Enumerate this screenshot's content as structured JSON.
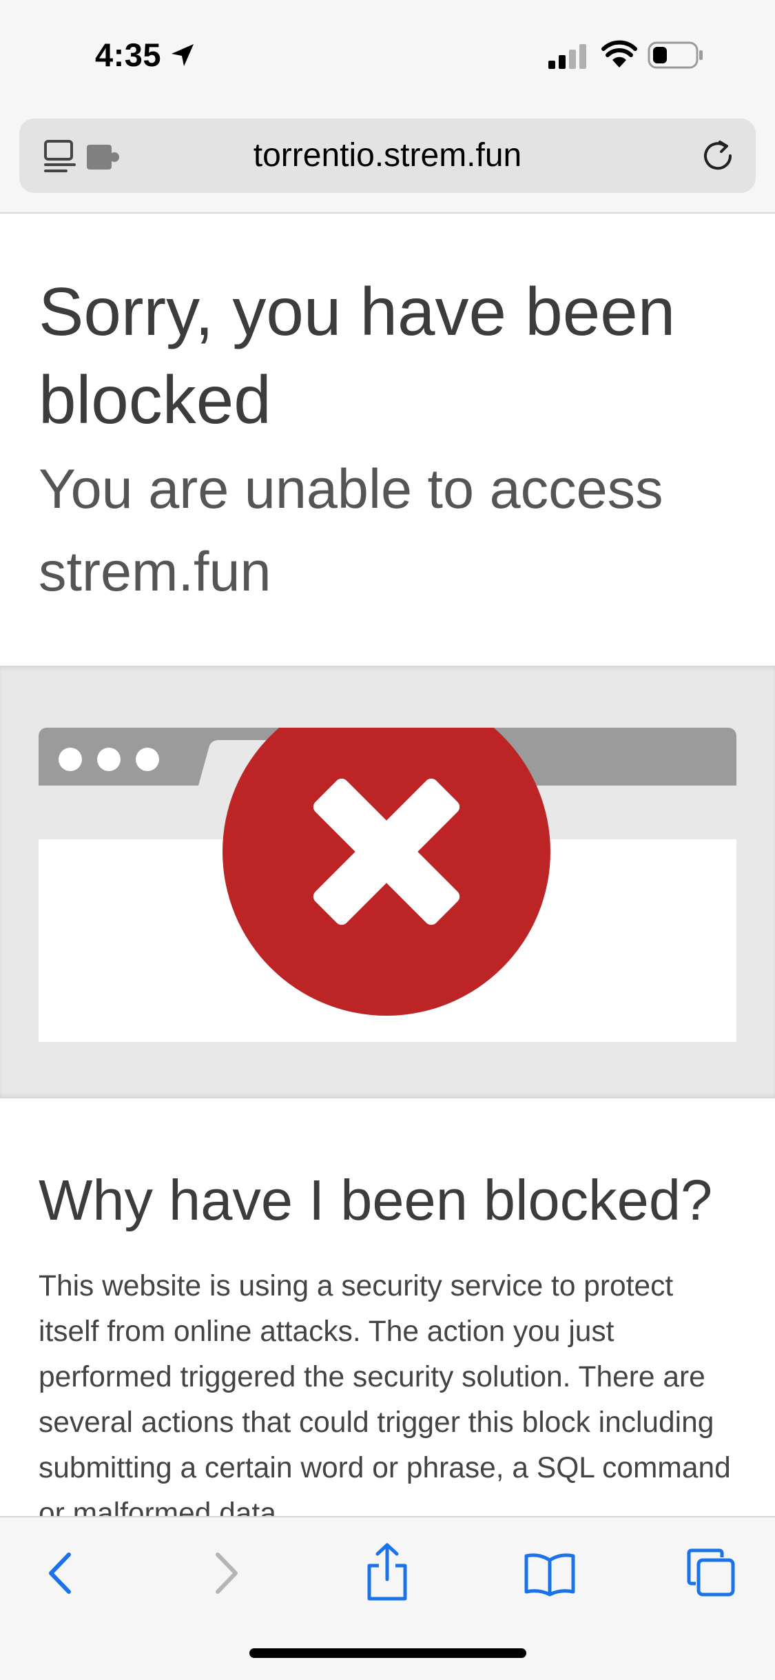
{
  "status_bar": {
    "time": "4:35",
    "icons": [
      "location-arrow-icon",
      "cellular-signal-icon",
      "wifi-icon",
      "battery-icon"
    ]
  },
  "address_bar": {
    "url": "torrentio.strem.fun",
    "icons": [
      "reader-mode-icon",
      "extension-icon",
      "reload-icon"
    ]
  },
  "page": {
    "title": "Sorry, you have been blocked",
    "subtitle": "You are unable to access strem.fun",
    "illustration_icons": [
      "browser-window-icon",
      "blocked-x-icon"
    ],
    "why_heading": "Why have I been blocked?",
    "why_body": "This website is using a security service to protect itself from online attacks. The action you just performed triggered the security solution. There are several actions that could trigger this block including submitting a certain word or phrase, a SQL command or malformed data."
  },
  "toolbar": {
    "buttons": [
      "back-icon",
      "forward-icon",
      "share-icon",
      "bookmarks-icon",
      "tabs-icon"
    ]
  },
  "colors": {
    "accent": "#1a73e8",
    "error_red": "#bd2426",
    "chrome_bg": "#f6f6f6",
    "address_bg": "#e3e3e3"
  }
}
